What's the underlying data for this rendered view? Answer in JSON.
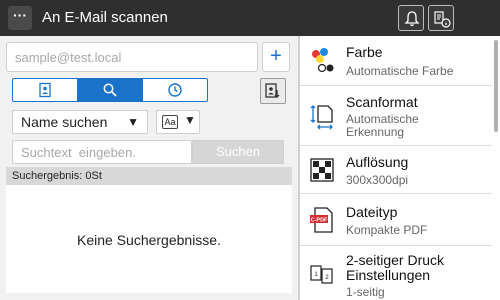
{
  "header": {
    "menu_label": "···",
    "title": "An  E-Mail  scannen"
  },
  "destination": {
    "email_placeholder": "sample@test.local",
    "add_label": "+"
  },
  "search": {
    "type_value": "Name  suchen",
    "type_arrow": "▼",
    "case_value": "Aa",
    "case_arrow": "▼",
    "input_placeholder": "Suchtext  eingeben.",
    "button_label": "Suchen",
    "result_header": "Suchergebnis:  0St",
    "empty_message": "Keine  Suchergebnisse."
  },
  "settings": [
    {
      "label": "Farbe",
      "value": "Automatische  Farbe",
      "icon": "color-icon"
    },
    {
      "label": "Scanformat",
      "value": "Automatische\nErkennung",
      "icon": "scan-size-icon"
    },
    {
      "label": "Auflösung",
      "value": "300x300dpi",
      "icon": "resolution-icon"
    },
    {
      "label": "Dateityp",
      "value": "Kompakte  PDF",
      "icon": "pdf-icon"
    },
    {
      "label": "2-seitiger  Druck\nEinstellungen",
      "value": "1-seitig",
      "icon": "duplex-icon"
    }
  ],
  "colors": {
    "accent": "#1a73c8",
    "header_bg": "#2f2f2f"
  }
}
